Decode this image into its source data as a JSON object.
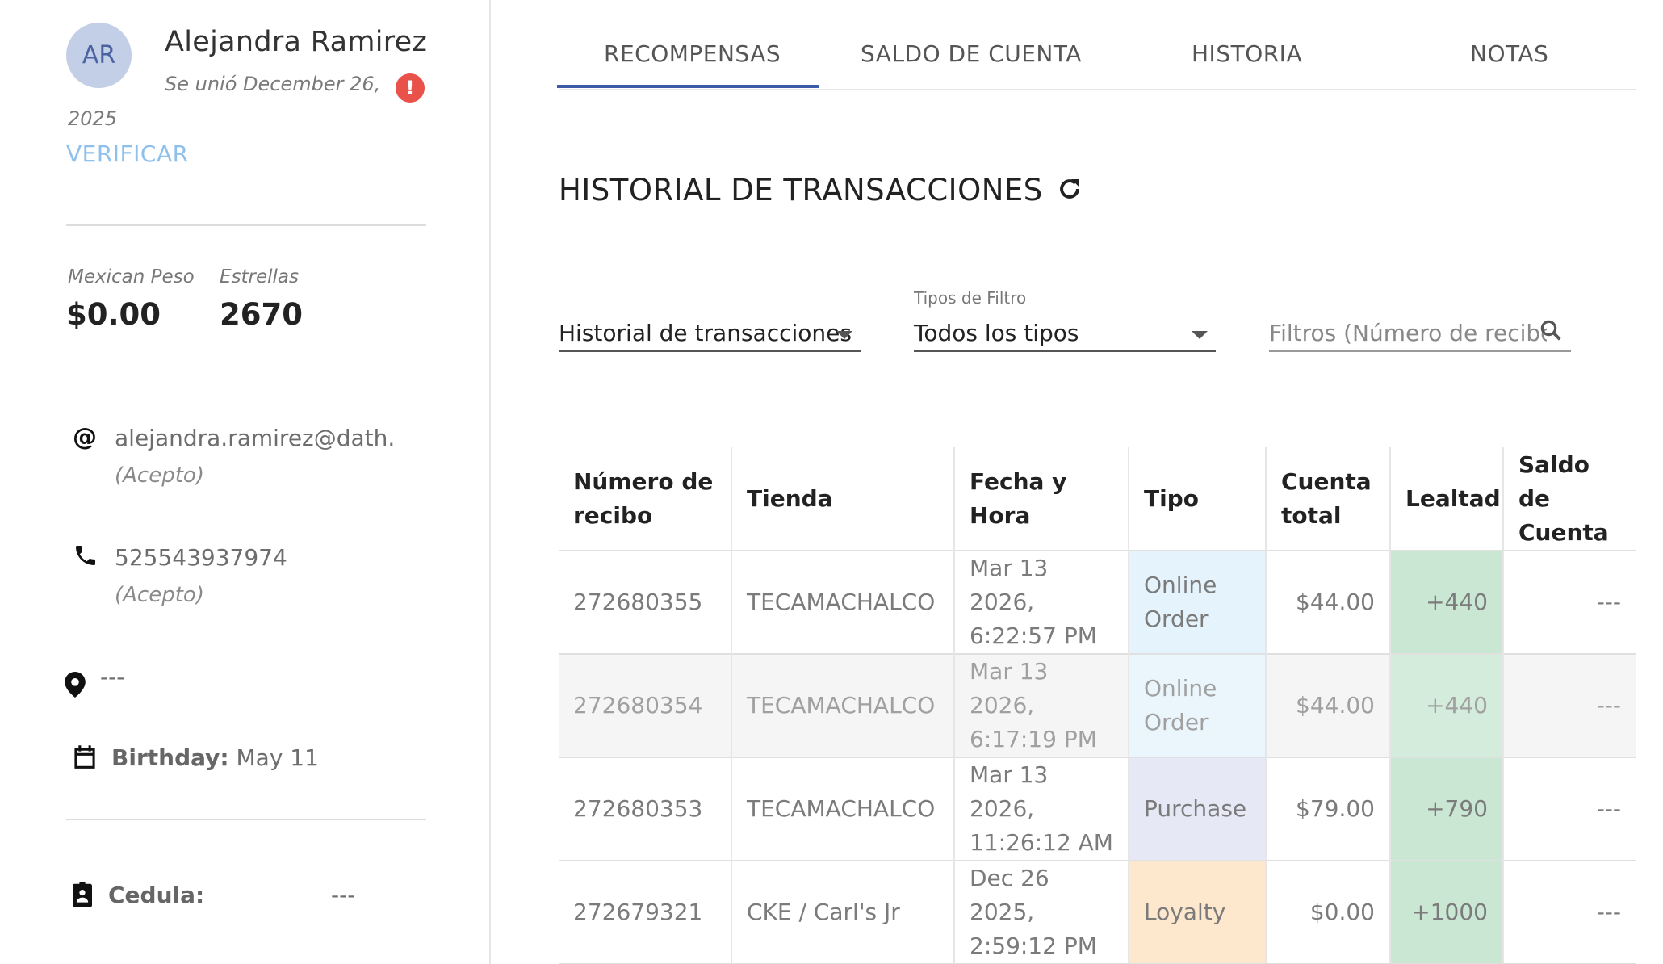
{
  "customer": {
    "initials": "AR",
    "name": "Alejandra Ramirez",
    "joined_line1": "Se unió December 26,",
    "joined_line2": "2025",
    "verify_label": "VERIFICAR",
    "currency_label": "Mexican Peso",
    "balance": "$0.00",
    "stars_label": "Estrellas",
    "stars": "2670",
    "email": "alejandra.ramirez@dath.",
    "email_status": "(Acepto)",
    "phone": "525543937974",
    "phone_status": "(Acepto)",
    "location": "---",
    "birthday_label": "Birthday:",
    "birthday": "May 11",
    "cedula_label": "Cedula:",
    "cedula": "---"
  },
  "tabs": [
    {
      "label": "RECOMPENSAS"
    },
    {
      "label": "SALDO DE CUENTA"
    },
    {
      "label": "HISTORIA",
      "active": true
    },
    {
      "label": "NOTAS"
    }
  ],
  "history": {
    "title": "HISTORIAL DE TRANSACCIONES",
    "history_select": "Historial de transacciones",
    "filter_label": "Tipos de Filtro",
    "filter_select": "Todos los tipos",
    "search_placeholder": "Filtros (Número de recibo, ..."
  },
  "table": {
    "headers": {
      "receipt": "Número de recibo",
      "store": "Tienda",
      "datetime": "Fecha y Hora",
      "type": "Tipo",
      "total": "Cuenta total",
      "loyalty": "Lealtad",
      "account": "Saldo de Cuenta"
    },
    "rows": [
      {
        "receipt": "272680355",
        "store": "TECAMACHALCO",
        "date": "Mar 13 2026,",
        "time": "6:22:57 PM",
        "type_1": "Online",
        "type_2": "Order",
        "total": "$44.00",
        "loyalty": "+440",
        "account": "---"
      },
      {
        "receipt": "272680354",
        "store": "TECAMACHALCO",
        "date": "Mar 13 2026,",
        "time": "6:17:19 PM",
        "type_1": "Online",
        "type_2": "Order",
        "total": "$44.00",
        "loyalty": "+440",
        "account": "---"
      },
      {
        "receipt": "272680353",
        "store": "TECAMACHALCO",
        "date": "Mar 13 2026,",
        "time": "11:26:12 AM",
        "type_1": "Purchase",
        "type_2": "",
        "total": "$79.00",
        "loyalty": "+790",
        "account": "---"
      },
      {
        "receipt": "272679321",
        "store": "CKE / Carl's Jr",
        "date": "Dec 26 2025,",
        "time": "2:59:12 PM",
        "type_1": "Loyalty",
        "type_2": "",
        "total": "$0.00",
        "loyalty": "+1000",
        "account": "---"
      }
    ]
  }
}
